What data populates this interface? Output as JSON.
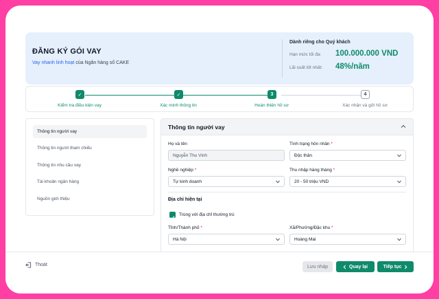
{
  "hero": {
    "title": "ĐĂNG KÝ GÓI VAY",
    "subtitle_link": "Vay nhanh linh hoạt",
    "subtitle_rest": " của Ngân hàng số CAKE",
    "offer_title": "Dành riêng cho Quý khách",
    "limit_label": "Hạn mức tối đa:",
    "limit_value": "100.000.000 VND",
    "rate_label": "Lãi suất tốt nhất:",
    "rate_value": "48%/năm"
  },
  "stepper": {
    "steps": [
      {
        "label": "Kiểm tra điều kiện vay",
        "status": "done",
        "marker": "✓"
      },
      {
        "label": "Xác minh thông tin",
        "status": "done",
        "marker": "✓"
      },
      {
        "label": "Hoàn thiện hồ sơ",
        "status": "active",
        "marker": "3"
      },
      {
        "label": "Xác nhận và gửi hồ sơ",
        "status": "todo",
        "marker": "4"
      }
    ]
  },
  "sidebar": {
    "items": [
      {
        "label": "Thông tin người vay",
        "active": true
      },
      {
        "label": "Thông tin người tham chiếu",
        "active": false
      },
      {
        "label": "Thông tin nhu cầu vay",
        "active": false
      },
      {
        "label": "Tài khoản ngân hàng",
        "active": false
      },
      {
        "label": "Nguồn giới thiệu",
        "active": false
      }
    ]
  },
  "form": {
    "title": "Thông tin người vay",
    "fullname_label": "Họ và tên",
    "fullname_value": "Nguyễn Thu Vinh",
    "marital_label": "Tình trạng hôn nhân",
    "marital_value": "Độc thân",
    "job_label": "Nghề nghiệp",
    "job_value": "Tự kinh doanh",
    "income_label": "Thu nhập hàng tháng",
    "income_value": "20 - 50 triệu VND",
    "address_section": "Địa chỉ hiện tại",
    "same_address_label": "Trùng với địa chỉ thường trú",
    "same_address_checked": true,
    "province_label": "Tỉnh/Thành phố",
    "province_value": "Hà Nội",
    "ward_label": "Xã/Phường/Đặc khu",
    "ward_value": "Hoàng Mai",
    "required_mark": "*"
  },
  "footer": {
    "exit_label": "Thoát",
    "save_label": "Lưu nháp",
    "back_label": "Quay lại",
    "next_label": "Tiếp tục"
  },
  "colors": {
    "accent": "#0f8a6a",
    "frame": "#ff3fa4",
    "hero_bg": "#e5f0fc",
    "required": "#dc2626"
  }
}
